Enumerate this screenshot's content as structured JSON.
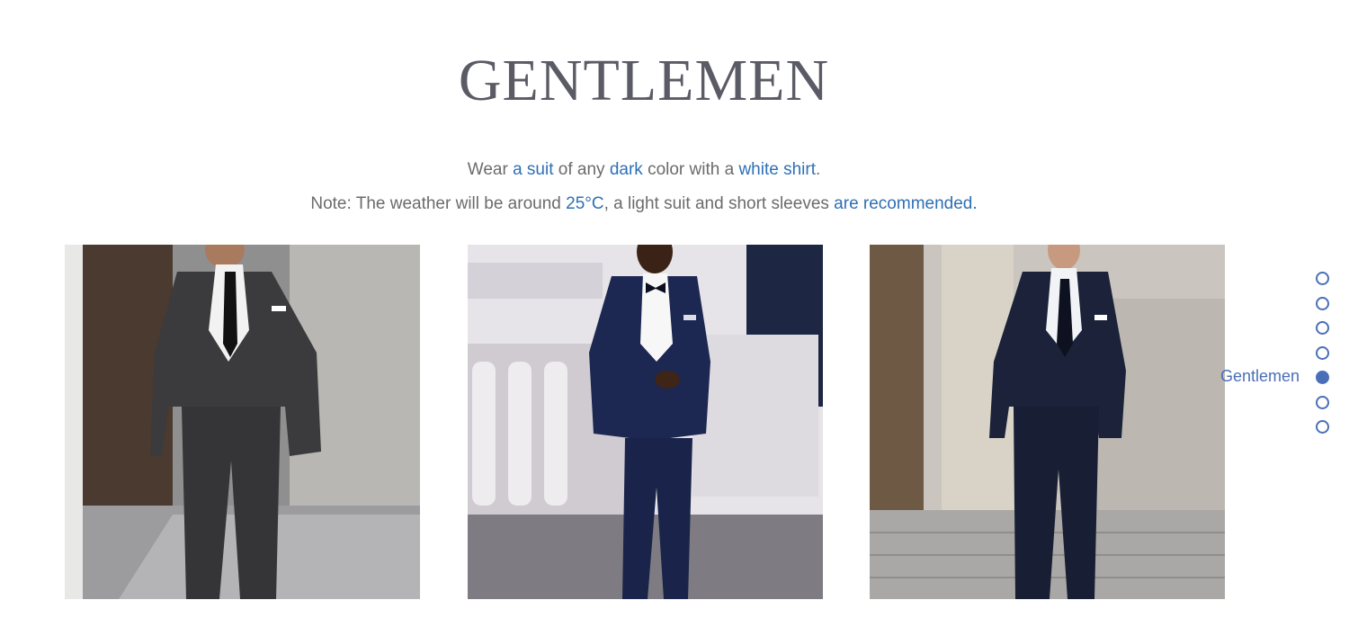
{
  "section": {
    "title": "GENTLEMEN",
    "line1": {
      "t1": "Wear ",
      "h1": "a suit",
      "t2": " of any ",
      "h2": "dark",
      "t3": " color with a ",
      "h3": "white shirt",
      "t4": "."
    },
    "line2": {
      "t1": "Note: The weather will be around ",
      "h1": "25°C",
      "t2": ", a light suit and short sleeves ",
      "h2": "are recommended."
    },
    "highlight_color": "#2f6fb5"
  },
  "photos": [
    {
      "subject": "man in charcoal gray suit with black tie"
    },
    {
      "subject": "man in navy tuxedo with bow tie"
    },
    {
      "subject": "man in navy suit on stone steps"
    }
  ],
  "side_nav": {
    "active_label": "Gentlemen",
    "dot_count": 7,
    "active_index": 4,
    "color": "#4a6fb8"
  }
}
